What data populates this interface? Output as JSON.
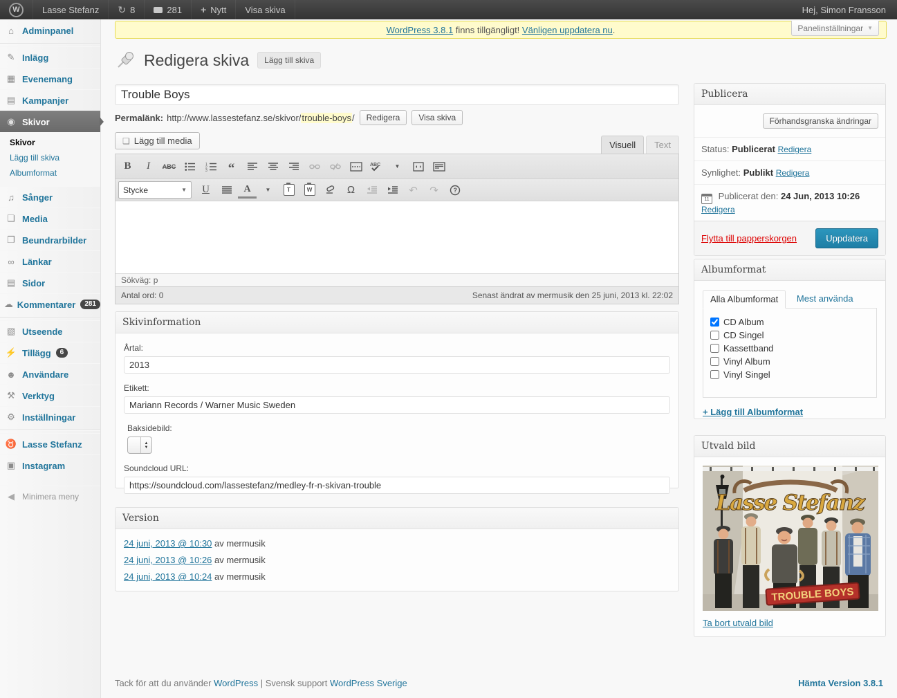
{
  "admin_bar": {
    "site_name": "Lasse Stefanz",
    "updates_count": "8",
    "comments_count": "281",
    "new_label": "Nytt",
    "view_label": "Visa skiva",
    "greeting": "Hej, Simon Fransson"
  },
  "notice": {
    "update_link": "WordPress 3.8.1",
    "middle": " finns tillgängligt! ",
    "action_link": "Vänligen uppdatera nu",
    "period": "."
  },
  "screen_options": {
    "label": "Panelinställningar"
  },
  "sidebar": {
    "items": [
      {
        "label": "Adminpanel"
      },
      {
        "label": "Inlägg"
      },
      {
        "label": "Evenemang"
      },
      {
        "label": "Kampanjer"
      },
      {
        "label": "Skivor"
      },
      {
        "label": "Sånger"
      },
      {
        "label": "Media"
      },
      {
        "label": "Beundrarbilder"
      },
      {
        "label": "Länkar"
      },
      {
        "label": "Sidor"
      },
      {
        "label": "Kommentarer",
        "badge": "281"
      },
      {
        "label": "Utseende"
      },
      {
        "label": "Tillägg",
        "badge": "6"
      },
      {
        "label": "Användare"
      },
      {
        "label": "Verktyg"
      },
      {
        "label": "Inställningar"
      },
      {
        "label": "Lasse Stefanz"
      },
      {
        "label": "Instagram"
      }
    ],
    "submenu": [
      {
        "label": "Skivor"
      },
      {
        "label": "Lägg till skiva"
      },
      {
        "label": "Albumformat"
      }
    ],
    "collapse_label": "Minimera meny"
  },
  "page": {
    "heading": "Redigera skiva",
    "add_button": "Lägg till skiva",
    "post_title": "Trouble Boys",
    "permalink_label": "Permalänk:",
    "permalink_base": "http://www.lassestefanz.se/skivor/",
    "permalink_slug": "trouble-boys",
    "permalink_tail": "/",
    "edit_button": "Redigera",
    "view_button": "Visa skiva"
  },
  "editor": {
    "add_media": "Lägg till media",
    "tab_visual": "Visuell",
    "tab_text": "Text",
    "format_value": "Stycke",
    "path": "Sökväg: p",
    "word_count": "Antal ord: 0",
    "last_edited": "Senast ändrat av mermusik den 25 juni, 2013 kl. 22:02"
  },
  "skivinformation": {
    "title": "Skivinformation",
    "year_label": "Årtal:",
    "year_value": "2013",
    "etikett_label": "Etikett:",
    "etikett_value": "Mariann Records / Warner Music Sweden",
    "back_label": "Baksidebild:",
    "soundcloud_label": "Soundcloud URL:",
    "soundcloud_value": "https://soundcloud.com/lassestefanz/medley-fr-n-skivan-trouble"
  },
  "versions": {
    "title": "Version",
    "items": [
      {
        "date": "24 juni, 2013 @ 10:30",
        "by": " av mermusik"
      },
      {
        "date": "24 juni, 2013 @ 10:26",
        "by": " av mermusik"
      },
      {
        "date": "24 juni, 2013 @ 10:24",
        "by": " av mermusik"
      }
    ]
  },
  "publish_box": {
    "title": "Publicera",
    "preview_button": "Förhandsgranska ändringar",
    "status_label": "Status:",
    "status_value": "Publicerat",
    "edit_status": "Redigera",
    "visibility_label": "Synlighet:",
    "visibility_value": "Publikt",
    "edit_visibility": "Redigera",
    "published_label": "Publicerat den:",
    "published_value": "24 Jun, 2013 10:26",
    "edit_date": "Redigera",
    "trash_link": "Flytta till papperskorgen",
    "update_button": "Uppdatera"
  },
  "albumformat_box": {
    "title": "Albumformat",
    "tab_all": "Alla Albumformat",
    "tab_used": "Mest använda",
    "options": [
      {
        "label": "CD Album",
        "checked": true
      },
      {
        "label": "CD Singel",
        "checked": false
      },
      {
        "label": "Kassettband",
        "checked": false
      },
      {
        "label": "Vinyl Album",
        "checked": false
      },
      {
        "label": "Vinyl Singel",
        "checked": false
      }
    ],
    "add_link": "+ Lägg till Albumformat"
  },
  "featured_box": {
    "title": "Utvald bild",
    "cover_band": "Lasse Stefanz",
    "cover_album": "TROUBLE BOYS",
    "remove_link": "Ta bort utvald bild"
  },
  "footer": {
    "thanks": "Tack för att du använder ",
    "wp_link": "WordPress",
    "mid": " | Svensk support ",
    "se_link": "WordPress Sverige",
    "version_link": "Hämta Version 3.8.1"
  },
  "colors": {
    "accent_blue": "#21759b",
    "notice_bg": "#fffbcc",
    "notice_border": "#e6db55",
    "primary_button": "#1e7ea5",
    "trash_red": "#dd0000",
    "slug_highlight": "#fffbcc"
  }
}
